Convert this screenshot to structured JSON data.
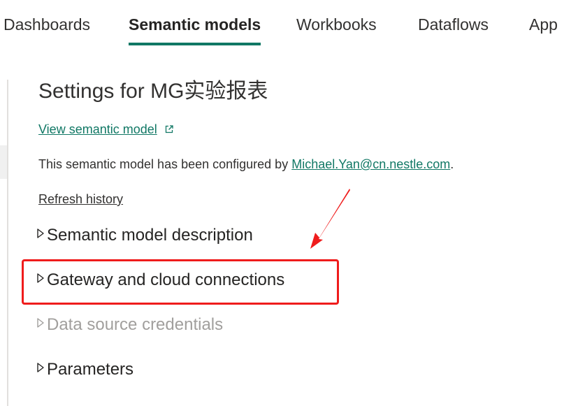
{
  "tabs": [
    {
      "label": "Dashboards",
      "active": false
    },
    {
      "label": "Semantic models",
      "active": true
    },
    {
      "label": "Workbooks",
      "active": false
    },
    {
      "label": "Dataflows",
      "active": false
    },
    {
      "label": "App",
      "active": false
    }
  ],
  "settings": {
    "title": "Settings for MG实验报表",
    "view_link": "View semantic model",
    "config_prefix": "This semantic model has been configured by ",
    "config_email": "Michael.Yan@cn.nestle.com",
    "config_suffix": ".",
    "refresh_history": "Refresh history"
  },
  "sections": [
    {
      "label": "Semantic model description",
      "enabled": true
    },
    {
      "label": "Gateway and cloud connections",
      "enabled": true,
      "highlighted": true
    },
    {
      "label": "Data source credentials",
      "enabled": false
    },
    {
      "label": "Parameters",
      "enabled": true
    }
  ],
  "colors": {
    "accent": "#117865",
    "annotation": "#ef1c1c",
    "disabled_text": "#a19f9d"
  },
  "icons": {
    "external_link": "external-link-icon",
    "caret": "caret-right-icon"
  }
}
